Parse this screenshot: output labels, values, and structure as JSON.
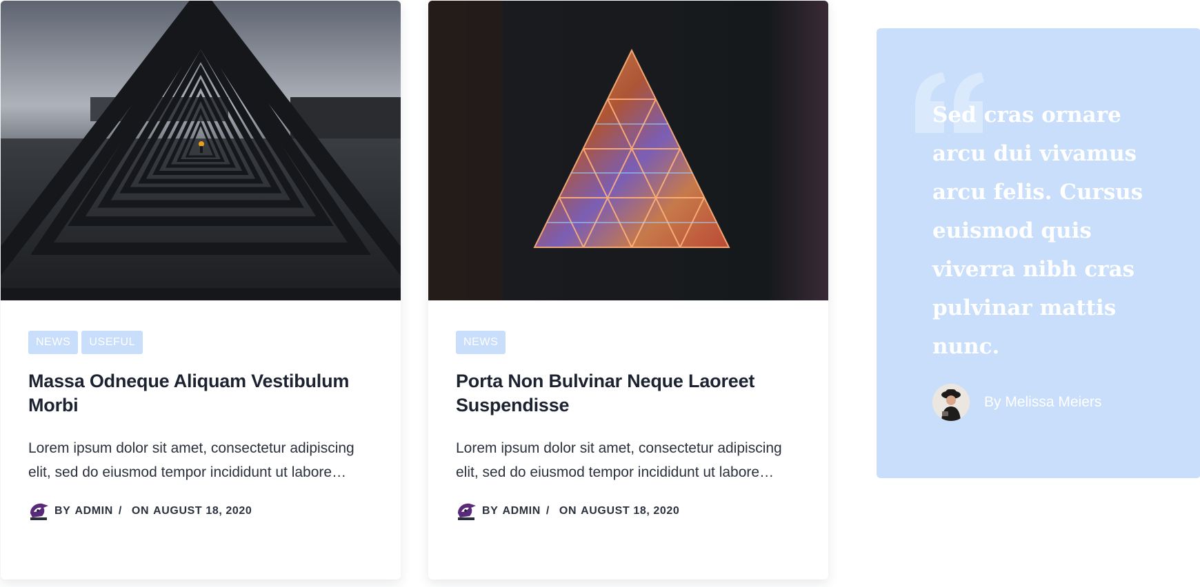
{
  "posts": [
    {
      "image_alt": "triangle-tunnel-photo",
      "tags": [
        "NEWS",
        "USEFUL"
      ],
      "title": "Massa Odneque Aliquam Vestibulum Morbi",
      "excerpt": "Lorem ipsum dolor sit amet, consectetur adipiscing elit, sed do eiusmod tempor incididunt ut labore…",
      "by_label": "BY",
      "author": "ADMIN",
      "separator": "/",
      "on_label": "ON",
      "date": "AUGUST 18, 2020"
    },
    {
      "image_alt": "neon-triangle-photo",
      "tags": [
        "NEWS"
      ],
      "title": "Porta Non Bulvinar Neque Laoreet Suspendisse",
      "excerpt": "Lorem ipsum dolor sit amet, consectetur adipiscing elit, sed do eiusmod tempor incididunt ut labore…",
      "by_label": "BY",
      "author": "ADMIN",
      "separator": "/",
      "on_label": "ON",
      "date": "AUGUST 18, 2020"
    }
  ],
  "testimonial": {
    "quote": "Sed cras ornare arcu dui vivamus arcu felis. Cursus euismod quis viverra nibh cras pulvinar mattis nunc.",
    "author": "By Melissa Meiers",
    "quote_icon": "quote-mark-icon"
  },
  "colors": {
    "tag_bg": "#c8defa",
    "quote_bg": "#c8defa",
    "title": "#1c2230",
    "text": "#2a303c"
  }
}
